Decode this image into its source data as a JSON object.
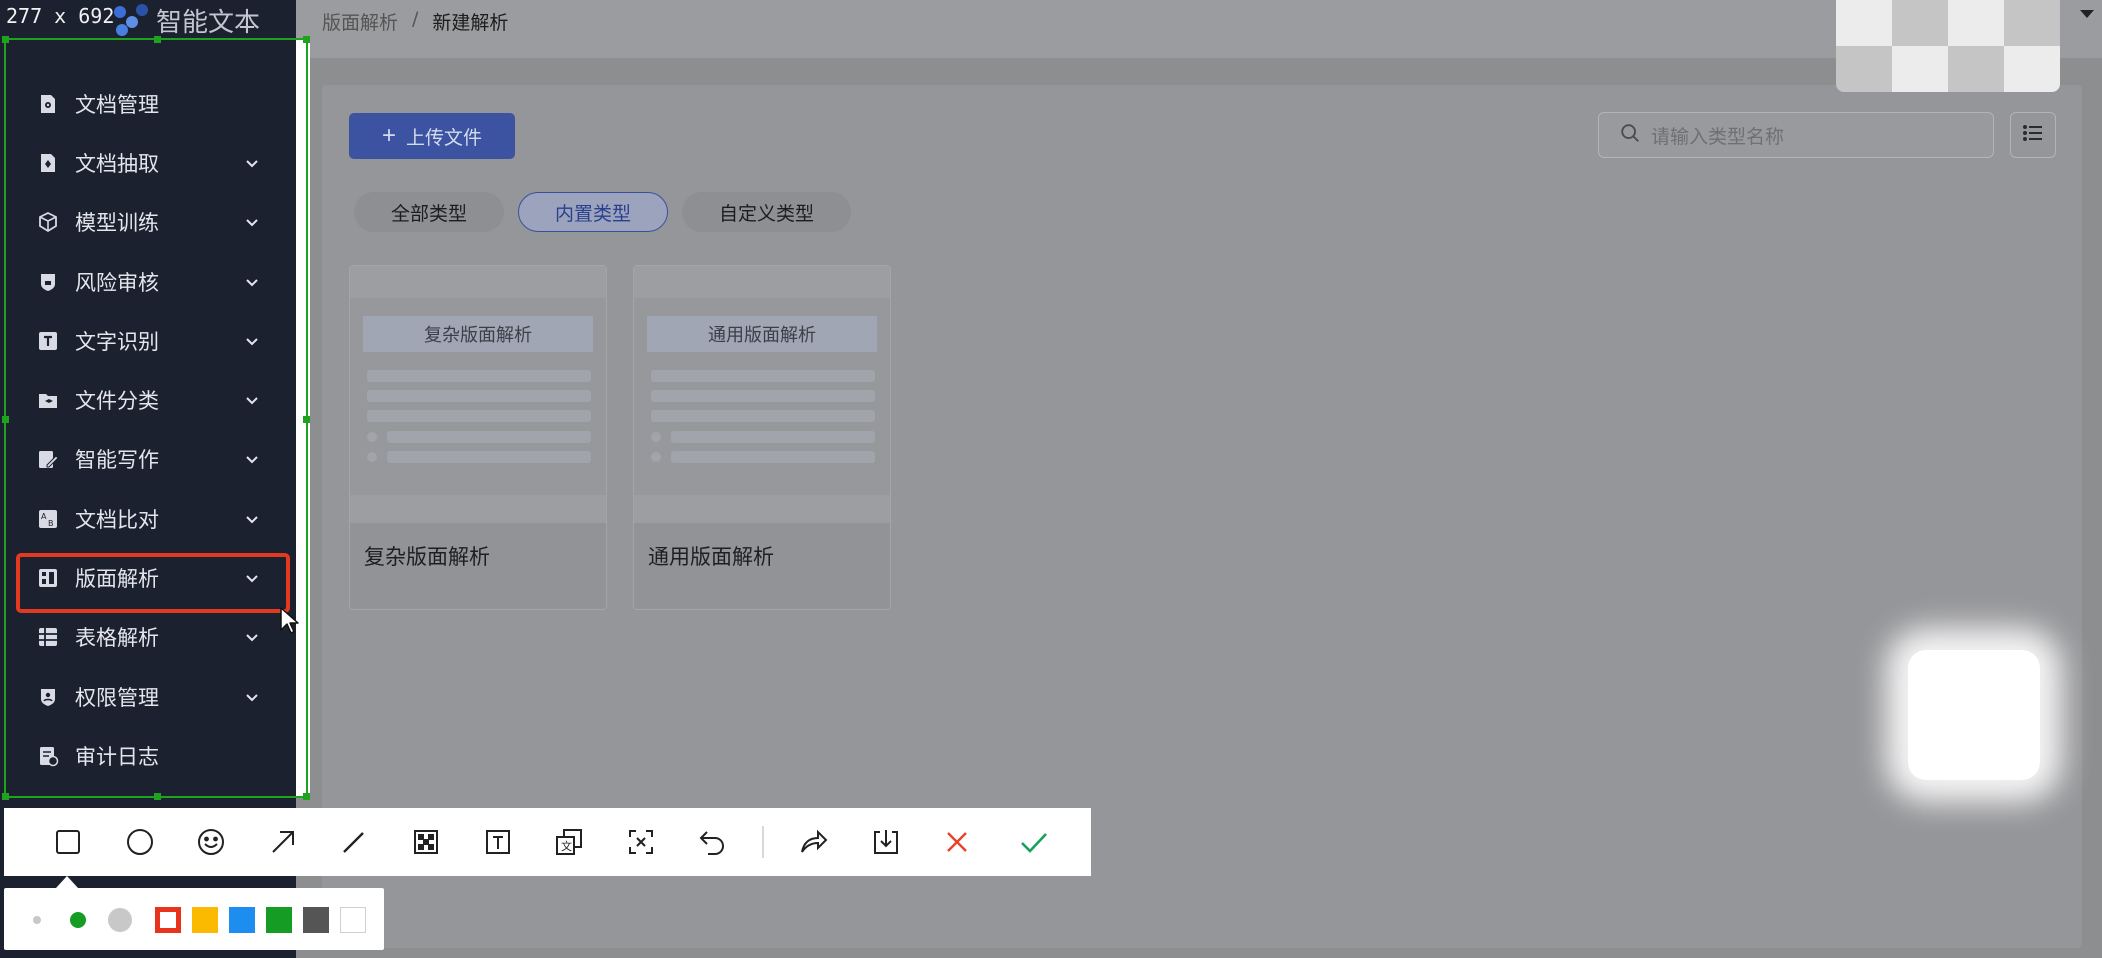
{
  "app": {
    "name": "智能文本"
  },
  "breadcrumb": {
    "parent": "版面解析",
    "separator": "/",
    "current": "新建解析"
  },
  "sidebar": {
    "items": [
      {
        "label": "文档管理",
        "icon": "doc-gear-icon",
        "expandable": false
      },
      {
        "label": "文档抽取",
        "icon": "doc-extract-icon",
        "expandable": true
      },
      {
        "label": "模型训练",
        "icon": "model-cube-icon",
        "expandable": true
      },
      {
        "label": "风险审核",
        "icon": "shield-check-icon",
        "expandable": true
      },
      {
        "label": "文字识别",
        "icon": "text-t-icon",
        "expandable": true
      },
      {
        "label": "文件分类",
        "icon": "folder-layers-icon",
        "expandable": true
      },
      {
        "label": "智能写作",
        "icon": "ai-pen-icon",
        "expandable": true
      },
      {
        "label": "文档比对",
        "icon": "compare-ab-icon",
        "expandable": true
      },
      {
        "label": "版面解析",
        "icon": "layout-parse-icon",
        "expandable": true
      },
      {
        "label": "表格解析",
        "icon": "table-grid-icon",
        "expandable": true
      },
      {
        "label": "权限管理",
        "icon": "shield-user-icon",
        "expandable": true
      },
      {
        "label": "审计日志",
        "icon": "audit-log-icon",
        "expandable": false
      }
    ]
  },
  "toolbar": {
    "upload_label": "上传文件"
  },
  "search": {
    "placeholder": "请输入类型名称"
  },
  "tabs": [
    {
      "label": "全部类型",
      "selected": false
    },
    {
      "label": "内置类型",
      "selected": true
    },
    {
      "label": "自定义类型",
      "selected": false
    }
  ],
  "cards": [
    {
      "thumb_title": "复杂版面解析",
      "name": "复杂版面解析"
    },
    {
      "thumb_title": "通用版面解析",
      "name": "通用版面解析"
    }
  ],
  "capture": {
    "size_label": "277 x 692",
    "tools": [
      "rectangle-icon",
      "circle-icon",
      "emoji-icon",
      "arrow-icon",
      "pen-icon",
      "mosaic-icon",
      "text-icon",
      "translate-icon",
      "ocr-icon",
      "undo-icon",
      "share-icon",
      "download-icon",
      "cancel-icon",
      "confirm-icon"
    ],
    "palette": {
      "colors": [
        "#e8341c",
        "#fbb900",
        "#1d8ef0",
        "#149c24",
        "#555555",
        "#ffffff"
      ],
      "selected_color": "#e8341c"
    }
  },
  "colors": {
    "accent": "#3b53a0",
    "highlight": "#e23a20",
    "selection": "#1fa31f"
  }
}
